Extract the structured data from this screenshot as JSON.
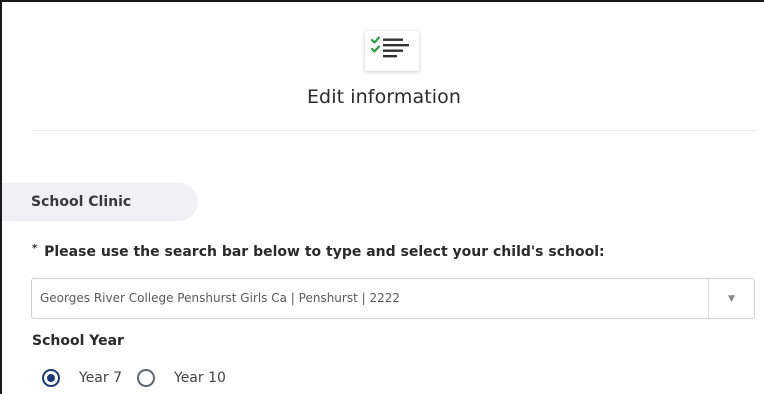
{
  "header": {
    "icon": "checklist-icon",
    "title": "Edit information",
    "accent_color": "#2e9d3f"
  },
  "section": {
    "tab_label": "School Clinic"
  },
  "school_search": {
    "required_marker": "*",
    "question": "Please use the search bar below to type and select your child's school:",
    "selected_value": "Georges River College Penshurst Girls Ca | Penshurst | 2222",
    "dropdown_icon": "caret-down-icon"
  },
  "school_year": {
    "label": "School Year",
    "options": [
      {
        "label": "Year 7",
        "selected": true
      },
      {
        "label": "Year 10",
        "selected": false
      }
    ],
    "selected_color": "#1a3a7a"
  }
}
